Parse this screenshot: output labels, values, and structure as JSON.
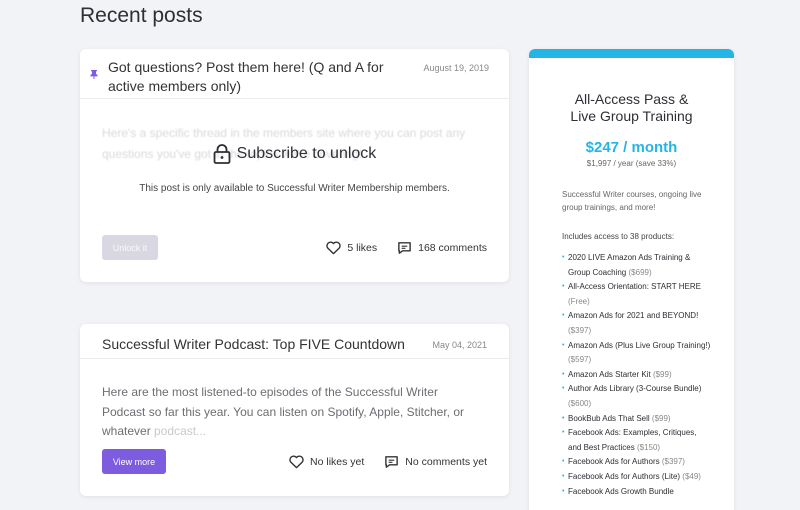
{
  "page": {
    "title": "Recent posts"
  },
  "posts": [
    {
      "title": "Got questions? Post them here! (Q and A for active members only)",
      "date": "August 19, 2019",
      "pin_icon": "pin-icon",
      "blurred_excerpt": "Here's a specific thread in the members site where you can post any questions you've got in the topics we're covering!",
      "locked_title": "Subscribe to unlock",
      "locked_note": "This post is only available to Successful Writer Membership members.",
      "button": "Unlock it",
      "likes": "5 likes",
      "comments": "168 comments"
    },
    {
      "title": "Successful Writer Podcast: Top FIVE Countdown",
      "date": "May 04, 2021",
      "excerpt_main": "Here are the most listened-to episodes of the Successful Writer Podcast so far this year. You can listen on Spotify, Apple, Stitcher, or whatever",
      "excerpt_fade": "podcast...",
      "button": "View more",
      "likes": "No likes yet",
      "comments": "No comments yet"
    }
  ],
  "sidebar": {
    "title_line1": "All-Access Pass &",
    "title_line2": "Live Group Training",
    "price": "$247 / month",
    "yearly": "$1,997 / year (save 33%)",
    "description": "Successful Writer courses, ongoing live group trainings, and more!",
    "includes": "Includes access to 38 products:",
    "products": [
      {
        "name": "2020 LIVE Amazon Ads Training & Group Coaching",
        "price": "($699)"
      },
      {
        "name": "All-Access Orientation: START HERE",
        "price": "(Free)"
      },
      {
        "name": "Amazon Ads for 2021 and BEYOND!",
        "price": "($397)"
      },
      {
        "name": "Amazon Ads (Plus Live Group Training!)",
        "price": "($597)"
      },
      {
        "name": "Amazon Ads Starter Kit",
        "price": "($99)"
      },
      {
        "name": "Author Ads Library (3-Course Bundle)",
        "price": "($600)"
      },
      {
        "name": "BookBub Ads That Sell",
        "price": "($99)"
      },
      {
        "name": "Facebook Ads: Examples, Critiques, and Best Practices",
        "price": "($150)"
      },
      {
        "name": "Facebook Ads for Authors",
        "price": "($397)"
      },
      {
        "name": "Facebook Ads for Authors (Lite)",
        "price": "($49)"
      },
      {
        "name": "Facebook Ads Growth Bundle",
        "price": ""
      }
    ]
  },
  "colors": {
    "accent": "#23b5e6",
    "primary_button": "#7d5ce0",
    "pin": "#7d5ce0"
  }
}
